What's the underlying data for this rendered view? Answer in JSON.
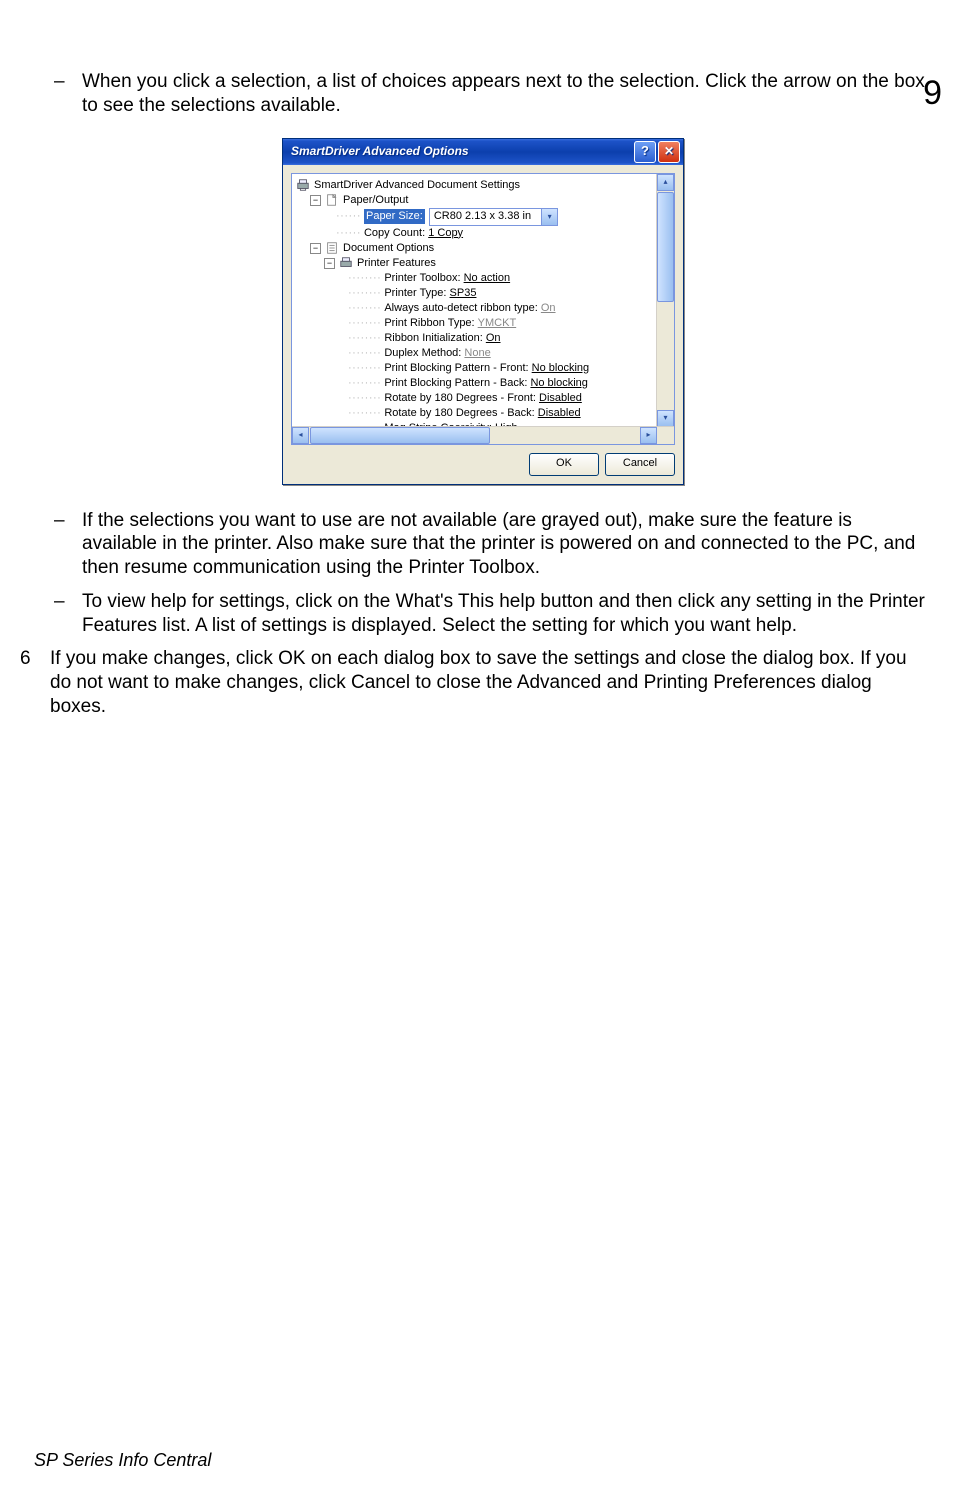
{
  "page": {
    "number": "9",
    "footer": "SP Series Info Central"
  },
  "paragraphs": {
    "p1": "When you click a selection, a list of choices appears next to the selection. Click the arrow on the box to see the selections available.",
    "p2": "If the selections you want to use are not available (are grayed out), make sure the feature is available in the printer. Also make sure that the printer is powered on and connected to the PC, and then resume communication using the Printer Toolbox.",
    "p3": "To view help for settings, click on the What's This help button and then click any setting in the Printer Features list. A list of settings is displayed. Select the setting for which you want help.",
    "p4_num": "6",
    "p4": "If you make changes, click OK on each dialog box to save the settings and close the dialog box. If you do not want to make changes, click Cancel to close the Advanced and Printing Preferences dialog boxes."
  },
  "dialog": {
    "title": "SmartDriver Advanced Options",
    "root": "SmartDriver Advanced Document Settings",
    "paper_output": "Paper/Output",
    "paper_size_label": "Paper Size:",
    "paper_size_value": "CR80 2.13 x 3.38 in",
    "copy_count_label": "Copy Count:",
    "copy_count_value": "1 Copy",
    "doc_options": "Document Options",
    "printer_features": "Printer Features",
    "features": {
      "toolbox": {
        "label": "Printer Toolbox:",
        "value": "No action"
      },
      "type": {
        "label": "Printer Type:",
        "value": "SP35"
      },
      "autodetect": {
        "label": "Always auto-detect ribbon type:",
        "value": "On"
      },
      "ribbon_type": {
        "label": "Print Ribbon Type:",
        "value": "YMCKT"
      },
      "ribbon_init": {
        "label": "Ribbon Initialization:",
        "value": "On"
      },
      "duplex": {
        "label": "Duplex Method:",
        "value": "None"
      },
      "block_front": {
        "label": "Print Blocking Pattern - Front:",
        "value": "No blocking"
      },
      "block_back": {
        "label": "Print Blocking Pattern - Back:",
        "value": "No blocking"
      },
      "rot_front": {
        "label": "Rotate by 180 Degrees - Front:",
        "value": "Disabled"
      },
      "rot_back": {
        "label": "Rotate by 180 Degrees - Back:",
        "value": "Disabled"
      },
      "mag": {
        "label": "Mag Stripe Coercivity:",
        "value": "High"
      }
    },
    "ok": "OK",
    "cancel": "Cancel"
  }
}
